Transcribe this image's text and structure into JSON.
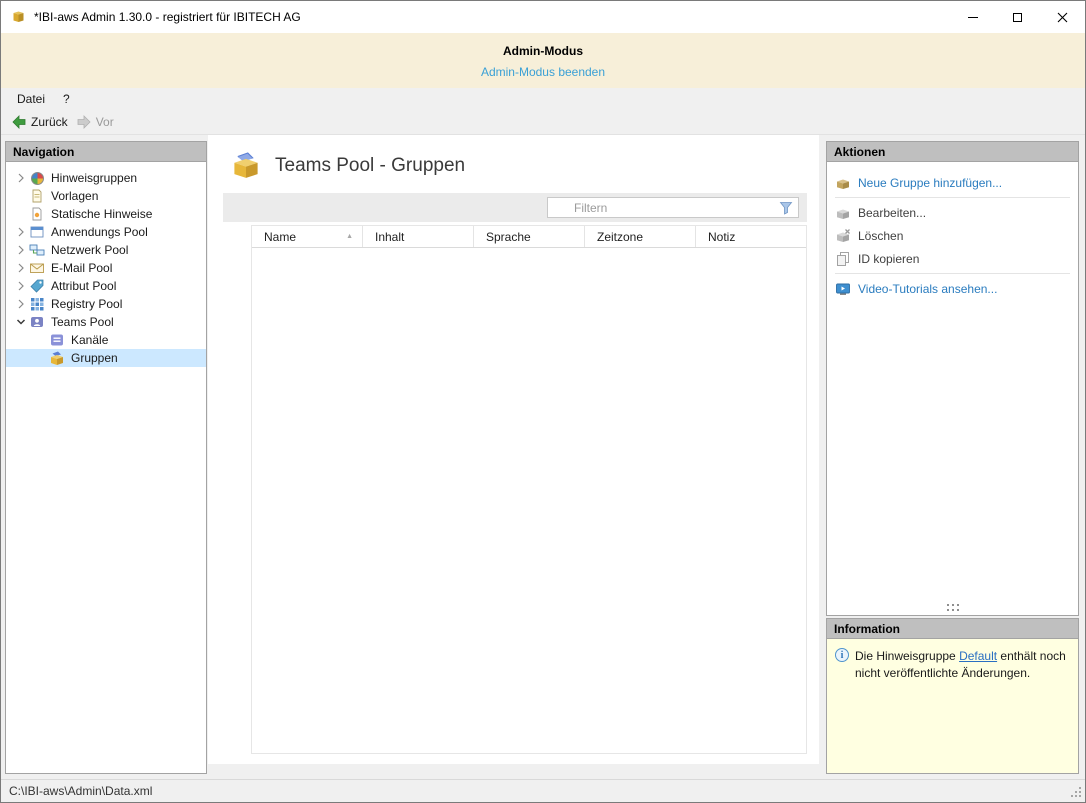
{
  "window": {
    "title": "*IBI-aws Admin 1.30.0 - registriert für IBITECH AG"
  },
  "admin_banner": {
    "title": "Admin-Modus",
    "link": "Admin-Modus beenden"
  },
  "menu": {
    "items": [
      {
        "label": "Datei"
      },
      {
        "label": "?"
      }
    ]
  },
  "toolbar": {
    "back": "Zurück",
    "forward": "Vor"
  },
  "navigation": {
    "header": "Navigation",
    "items": [
      {
        "label": "Hinweisgruppen",
        "icon": "hinweisgruppen-icon",
        "expand": "collapsed"
      },
      {
        "label": "Vorlagen",
        "icon": "vorlagen-icon"
      },
      {
        "label": "Statische Hinweise",
        "icon": "statische-hinweise-icon"
      },
      {
        "label": "Anwendungs Pool",
        "icon": "anwendungs-pool-icon",
        "expand": "collapsed"
      },
      {
        "label": "Netzwerk Pool",
        "icon": "netzwerk-pool-icon",
        "expand": "collapsed"
      },
      {
        "label": "E-Mail Pool",
        "icon": "email-pool-icon",
        "expand": "collapsed"
      },
      {
        "label": "Attribut Pool",
        "icon": "attribut-pool-icon",
        "expand": "collapsed"
      },
      {
        "label": "Registry Pool",
        "icon": "registry-pool-icon",
        "expand": "collapsed"
      },
      {
        "label": "Teams Pool",
        "icon": "teams-pool-icon",
        "expand": "expanded"
      },
      {
        "label": "Kanäle",
        "icon": "kanaele-icon",
        "child": true
      },
      {
        "label": "Gruppen",
        "icon": "gruppen-icon",
        "child": true,
        "selected": true
      }
    ]
  },
  "main": {
    "title": "Teams Pool - Gruppen",
    "filter_placeholder": "Filtern",
    "columns": [
      "Name",
      "Inhalt",
      "Sprache",
      "Zeitzone",
      "Notiz"
    ],
    "sort": {
      "column": "Name",
      "direction": "asc"
    },
    "rows": []
  },
  "actions": {
    "header": "Aktionen",
    "items": [
      {
        "label": "Neue Gruppe hinzufügen...",
        "type": "link",
        "icon": "add-group-icon"
      },
      {
        "label": "Bearbeiten...",
        "type": "plain",
        "icon": "edit-icon"
      },
      {
        "label": "Löschen",
        "type": "plain",
        "icon": "delete-icon"
      },
      {
        "label": "ID kopieren",
        "type": "plain",
        "icon": "copy-id-icon"
      },
      {
        "label": "Video-Tutorials ansehen...",
        "type": "link",
        "icon": "video-tutorials-icon"
      }
    ]
  },
  "information": {
    "header": "Information",
    "text_before": "Die Hinweisgruppe ",
    "link": "Default",
    "text_after": " enthält noch nicht veröffentlichte Änderungen."
  },
  "statusbar": {
    "path": "C:\\IBI-aws\\Admin\\Data.xml"
  },
  "colors": {
    "selection": "#cce8ff",
    "banner": "#f7efd9",
    "info_bg": "#ffffe1",
    "link": "#2a7cbf"
  }
}
